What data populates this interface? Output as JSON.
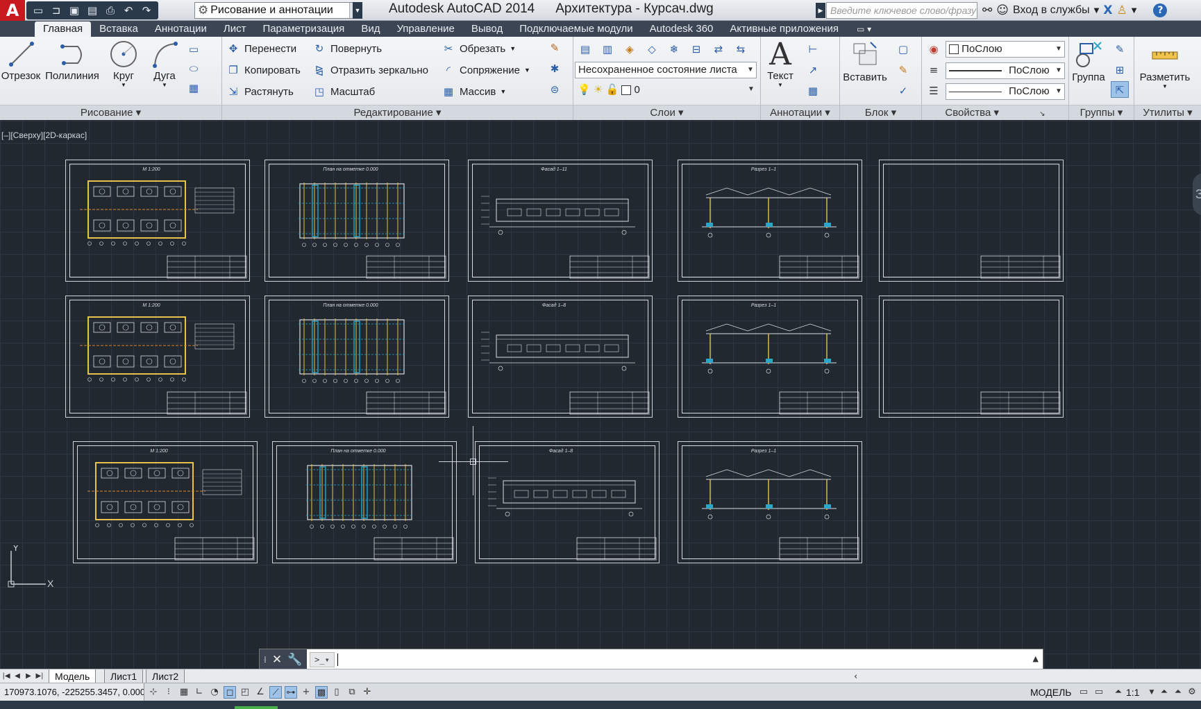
{
  "app": {
    "logo": "A",
    "title": "Autodesk AutoCAD 2014",
    "filename": "Архитектура - Курсач.dwg",
    "workspace": "Рисование и аннотации",
    "search_placeholder": "Введите ключевое слово/фразу",
    "signin": "Вход в службы",
    "help": "?"
  },
  "tabs": [
    "Главная",
    "Вставка",
    "Аннотации",
    "Лист",
    "Параметризация",
    "Вид",
    "Управление",
    "Вывод",
    "Подключаемые модули",
    "Autodesk 360",
    "Активные приложения"
  ],
  "ribbon": {
    "draw": {
      "title": "Рисование",
      "line": "Отрезок",
      "polyline": "Полилиния",
      "circle": "Круг",
      "arc": "Дуга"
    },
    "modify": {
      "title": "Редактирование",
      "move": "Перенести",
      "rotate": "Повернуть",
      "trim": "Обрезать",
      "copy": "Копировать",
      "mirror": "Отразить зеркально",
      "fillet": "Сопряжение",
      "stretch": "Растянуть",
      "scale": "Масштаб",
      "array": "Массив"
    },
    "layers": {
      "title": "Слои",
      "state": "Несохраненное состояние листа",
      "current": "0"
    },
    "annotation": {
      "title": "Аннотации",
      "text": "Текст"
    },
    "block": {
      "title": "Блок",
      "insert": "Вставить"
    },
    "properties": {
      "title": "Свойства",
      "color": "ПоСлою",
      "linetype": "ПоСлою",
      "lineweight": "ПоСлою"
    },
    "groups": {
      "title": "Группы",
      "group": "Группа"
    },
    "utilities": {
      "title": "Утилиты",
      "measure": "Разметить"
    }
  },
  "viewport": {
    "label": "[–][Сверху][2D-каркас]",
    "nav_badge": "З",
    "ucs_x": "X",
    "ucs_y": "Y"
  },
  "sheets": [
    {
      "row": 1,
      "col": 1,
      "title": "М 1:200",
      "type": "plan-rooms"
    },
    {
      "row": 1,
      "col": 2,
      "title": "План на отметке 0.000",
      "type": "plan-structural"
    },
    {
      "row": 1,
      "col": 3,
      "title": "Фасад 1–11",
      "type": "facade"
    },
    {
      "row": 1,
      "col": 4,
      "title": "Разрез 1–1",
      "type": "section"
    },
    {
      "row": 1,
      "col": 5,
      "title": "",
      "type": "blank"
    },
    {
      "row": 2,
      "col": 1,
      "title": "М 1:200",
      "type": "plan-rooms"
    },
    {
      "row": 2,
      "col": 2,
      "title": "План на отметке 0.000",
      "type": "plan-structural"
    },
    {
      "row": 2,
      "col": 3,
      "title": "Фасад 1–8",
      "type": "facade"
    },
    {
      "row": 2,
      "col": 4,
      "title": "Разрез 1–1",
      "type": "section"
    },
    {
      "row": 2,
      "col": 5,
      "title": "",
      "type": "blank"
    },
    {
      "row": 3,
      "col": 1,
      "title": "М 1:200",
      "type": "plan-rooms"
    },
    {
      "row": 3,
      "col": 2,
      "title": "План на отметке 0.000",
      "type": "plan-structural"
    },
    {
      "row": 3,
      "col": 3,
      "title": "Фасад 1–8",
      "type": "facade"
    },
    {
      "row": 3,
      "col": 4,
      "title": "Разрез 1–1",
      "type": "section"
    }
  ],
  "layout_tabs": [
    "Модель",
    "Лист1",
    "Лист2"
  ],
  "status": {
    "coords": "170973.1076, -225255.3457, 0.0000",
    "model": "МОДЕЛЬ",
    "scale": "1:1"
  },
  "colors": {
    "canvas": "#212830",
    "sheet_line": "#d9dde2",
    "axis_yellow": "#e8c24a",
    "column_cyan": "#2aa6c8",
    "orange": "#d9822b"
  }
}
